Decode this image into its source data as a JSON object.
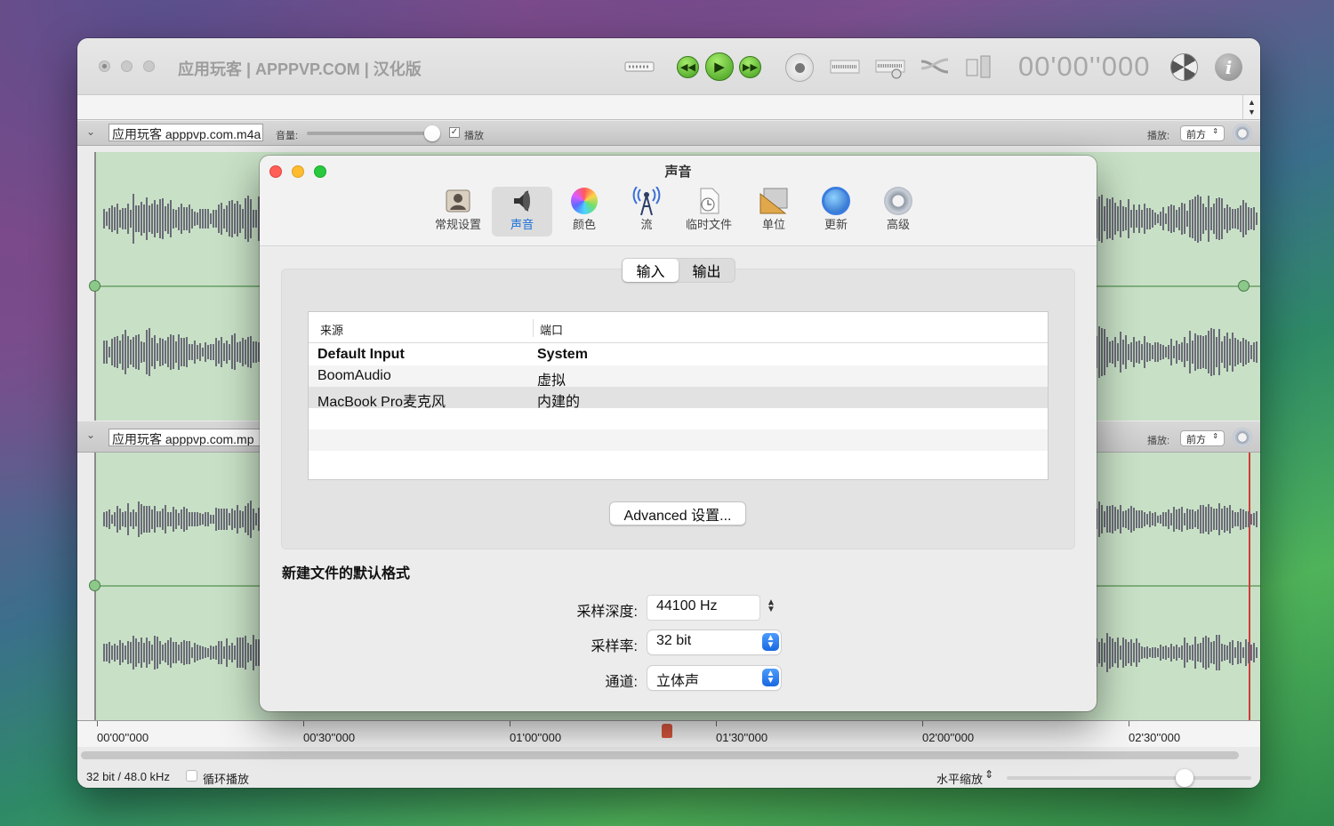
{
  "app": {
    "title": "应用玩客 | APPPVP.COM | 汉化版",
    "time": "00'00''000"
  },
  "tracks": [
    {
      "filename": "应用玩客 apppvp.com.m4a",
      "volume_label": "音量:",
      "play_checkbox": "播放",
      "playback_label": "播放:",
      "playback_value": "前方"
    },
    {
      "filename": "应用玩客 apppvp.com.mp",
      "playback_label": "播放:",
      "playback_value": "前方"
    }
  ],
  "ruler": {
    "ticks": [
      "00'00''000",
      "00'30''000",
      "01'00''000",
      "01'30''000",
      "02'00''000",
      "02'30''000"
    ]
  },
  "status": {
    "format": "32 bit / 48.0 kHz",
    "loop_label": "循环播放",
    "zoom_label": "水平缩放"
  },
  "dialog": {
    "title": "声音",
    "tabs": [
      {
        "label": "常规设置",
        "icon": "person-icon"
      },
      {
        "label": "声音",
        "icon": "speaker-icon",
        "selected": true
      },
      {
        "label": "颜色",
        "icon": "color-wheel-icon"
      },
      {
        "label": "流",
        "icon": "antenna-icon"
      },
      {
        "label": "临时文件",
        "icon": "clock-file-icon"
      },
      {
        "label": "单位",
        "icon": "ruler-icon"
      },
      {
        "label": "更新",
        "icon": "globe-update-icon"
      },
      {
        "label": "高级",
        "icon": "gear-icon"
      }
    ],
    "segment": {
      "input": "输入",
      "output": "输出"
    },
    "table": {
      "headers": [
        "来源",
        "端口"
      ],
      "rows": [
        {
          "source": "Default Input",
          "port": "System",
          "bold": true
        },
        {
          "source": "BoomAudio",
          "port": "虚拟"
        },
        {
          "source": "MacBook Pro麦克风",
          "port": "内建的",
          "selected": true
        }
      ]
    },
    "advanced_button": "Advanced 设置...",
    "section_title": "新建文件的默认格式",
    "fields": [
      {
        "label": "采样深度:",
        "value": "44100 Hz"
      },
      {
        "label": "采样率:",
        "value": "32 bit"
      },
      {
        "label": "通道:",
        "value": "立体声"
      }
    ]
  }
}
